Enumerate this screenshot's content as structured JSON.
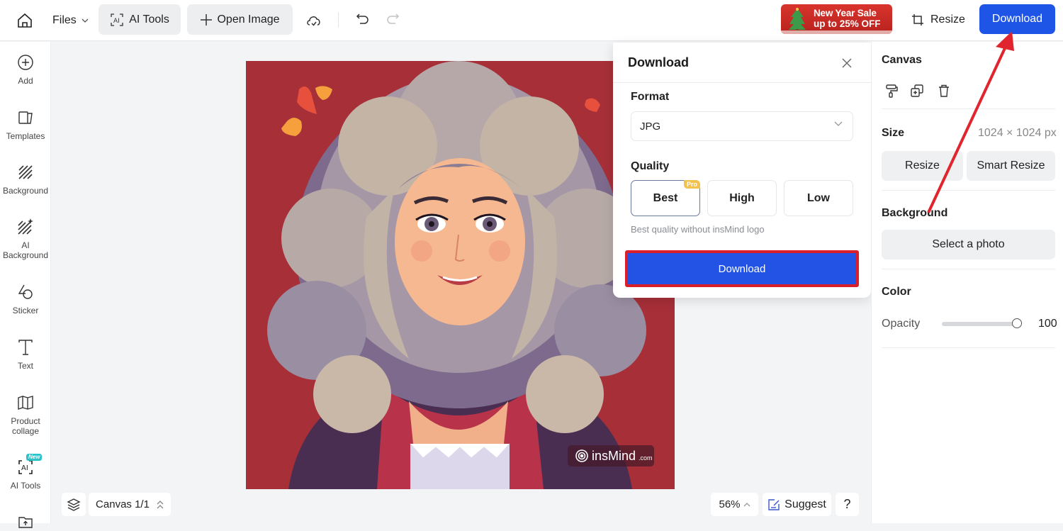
{
  "topbar": {
    "files_label": "Files",
    "ai_tools_label": "AI Tools",
    "open_image_label": "Open Image",
    "promo": {
      "line1": "New Year Sale",
      "line2": "up to 25% OFF"
    },
    "resize_label": "Resize",
    "download_label": "Download"
  },
  "sidebar": {
    "items": [
      {
        "label": "Add",
        "icon": "plus-circle-icon"
      },
      {
        "label": "Templates",
        "icon": "templates-icon"
      },
      {
        "label": "Background",
        "icon": "background-hatch-icon"
      },
      {
        "label": "AI Background",
        "icon": "ai-background-icon"
      },
      {
        "label": "Sticker",
        "icon": "sticker-icon"
      },
      {
        "label": "Text",
        "icon": "text-icon"
      },
      {
        "label": "Product collage",
        "icon": "collage-icon"
      },
      {
        "label": "AI Tools",
        "icon": "ai-tools-icon",
        "badge": "New"
      },
      {
        "label": "",
        "icon": "upload-folder-icon"
      }
    ]
  },
  "canvas": {
    "watermark_brand": "insMind",
    "watermark_suffix": ".com",
    "pager_label": "Canvas 1/1",
    "zoom_level": "56%",
    "suggest_label": "Suggest",
    "help_label": "?"
  },
  "download_panel": {
    "title": "Download",
    "format_label": "Format",
    "format_value": "JPG",
    "quality_label": "Quality",
    "quality_options": [
      {
        "label": "Best",
        "badge": "Pro",
        "selected": true
      },
      {
        "label": "High",
        "selected": false
      },
      {
        "label": "Low",
        "selected": false
      }
    ],
    "hint": "Best quality without insMind logo",
    "download_button": "Download"
  },
  "right_panel": {
    "canvas_heading": "Canvas",
    "size_heading": "Size",
    "size_value": "1024 × 1024 px",
    "resize_button": "Resize",
    "smart_resize_button": "Smart Resize",
    "background_heading": "Background",
    "select_photo_button": "Select a photo",
    "color_heading": "Color",
    "color_value": "#ffffff",
    "opacity_label": "Opacity",
    "opacity_value": "100",
    "opacity_fraction": 1.0
  },
  "colors": {
    "primary": "#1f55e6",
    "highlight_red": "#d81f2a",
    "canvas_bg": "#a62f38",
    "pro_badge": "#f2c14e",
    "new_badge": "#2bc3c8"
  }
}
